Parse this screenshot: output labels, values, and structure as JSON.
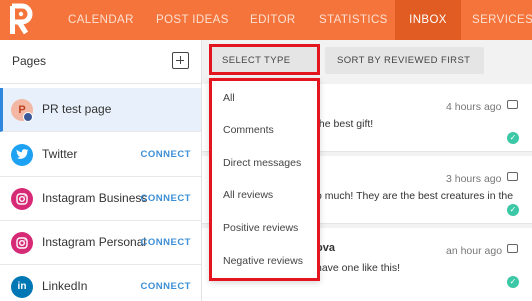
{
  "topnav": {
    "items": [
      {
        "label": "CALENDAR"
      },
      {
        "label": "POST IDEAS"
      },
      {
        "label": "EDITOR"
      },
      {
        "label": "STATISTICS"
      },
      {
        "label": "INBOX"
      },
      {
        "label": "SERVICES"
      }
    ],
    "active": "INBOX",
    "accent_color": "#f4743b",
    "active_color": "#e05c22"
  },
  "sidebar": {
    "title": "Pages",
    "add_icon": "plus-square-icon",
    "pages": [
      {
        "label": "PR test page",
        "icon": "pr-avatar-icon",
        "action": "",
        "selected": true
      },
      {
        "label": "Twitter",
        "icon": "twitter-icon",
        "action": "CONNECT"
      },
      {
        "label": "Instagram Business",
        "icon": "instagram-icon",
        "action": "CONNECT"
      },
      {
        "label": "Instagram Personal",
        "icon": "instagram-icon",
        "action": "CONNECT"
      },
      {
        "label": "LinkedIn",
        "icon": "linkedin-icon",
        "action": "CONNECT"
      }
    ]
  },
  "toolbar": {
    "select_type_label": "SELECT TYPE",
    "sort_label": "SORT BY REVIEWED FIRST"
  },
  "dropdown": {
    "options": [
      "All",
      "Comments",
      "Direct messages",
      "All reviews",
      "Positive reviews",
      "Negative reviews"
    ]
  },
  "messages": [
    {
      "author": "",
      "time": "4 hours ago",
      "text": "the best gift!"
    },
    {
      "author": "",
      "time": "3 hours ago",
      "text": "o much! They are the best creatures in the"
    },
    {
      "author": "ova",
      "time": "an hour ago",
      "text": "have one like this!"
    }
  ]
}
